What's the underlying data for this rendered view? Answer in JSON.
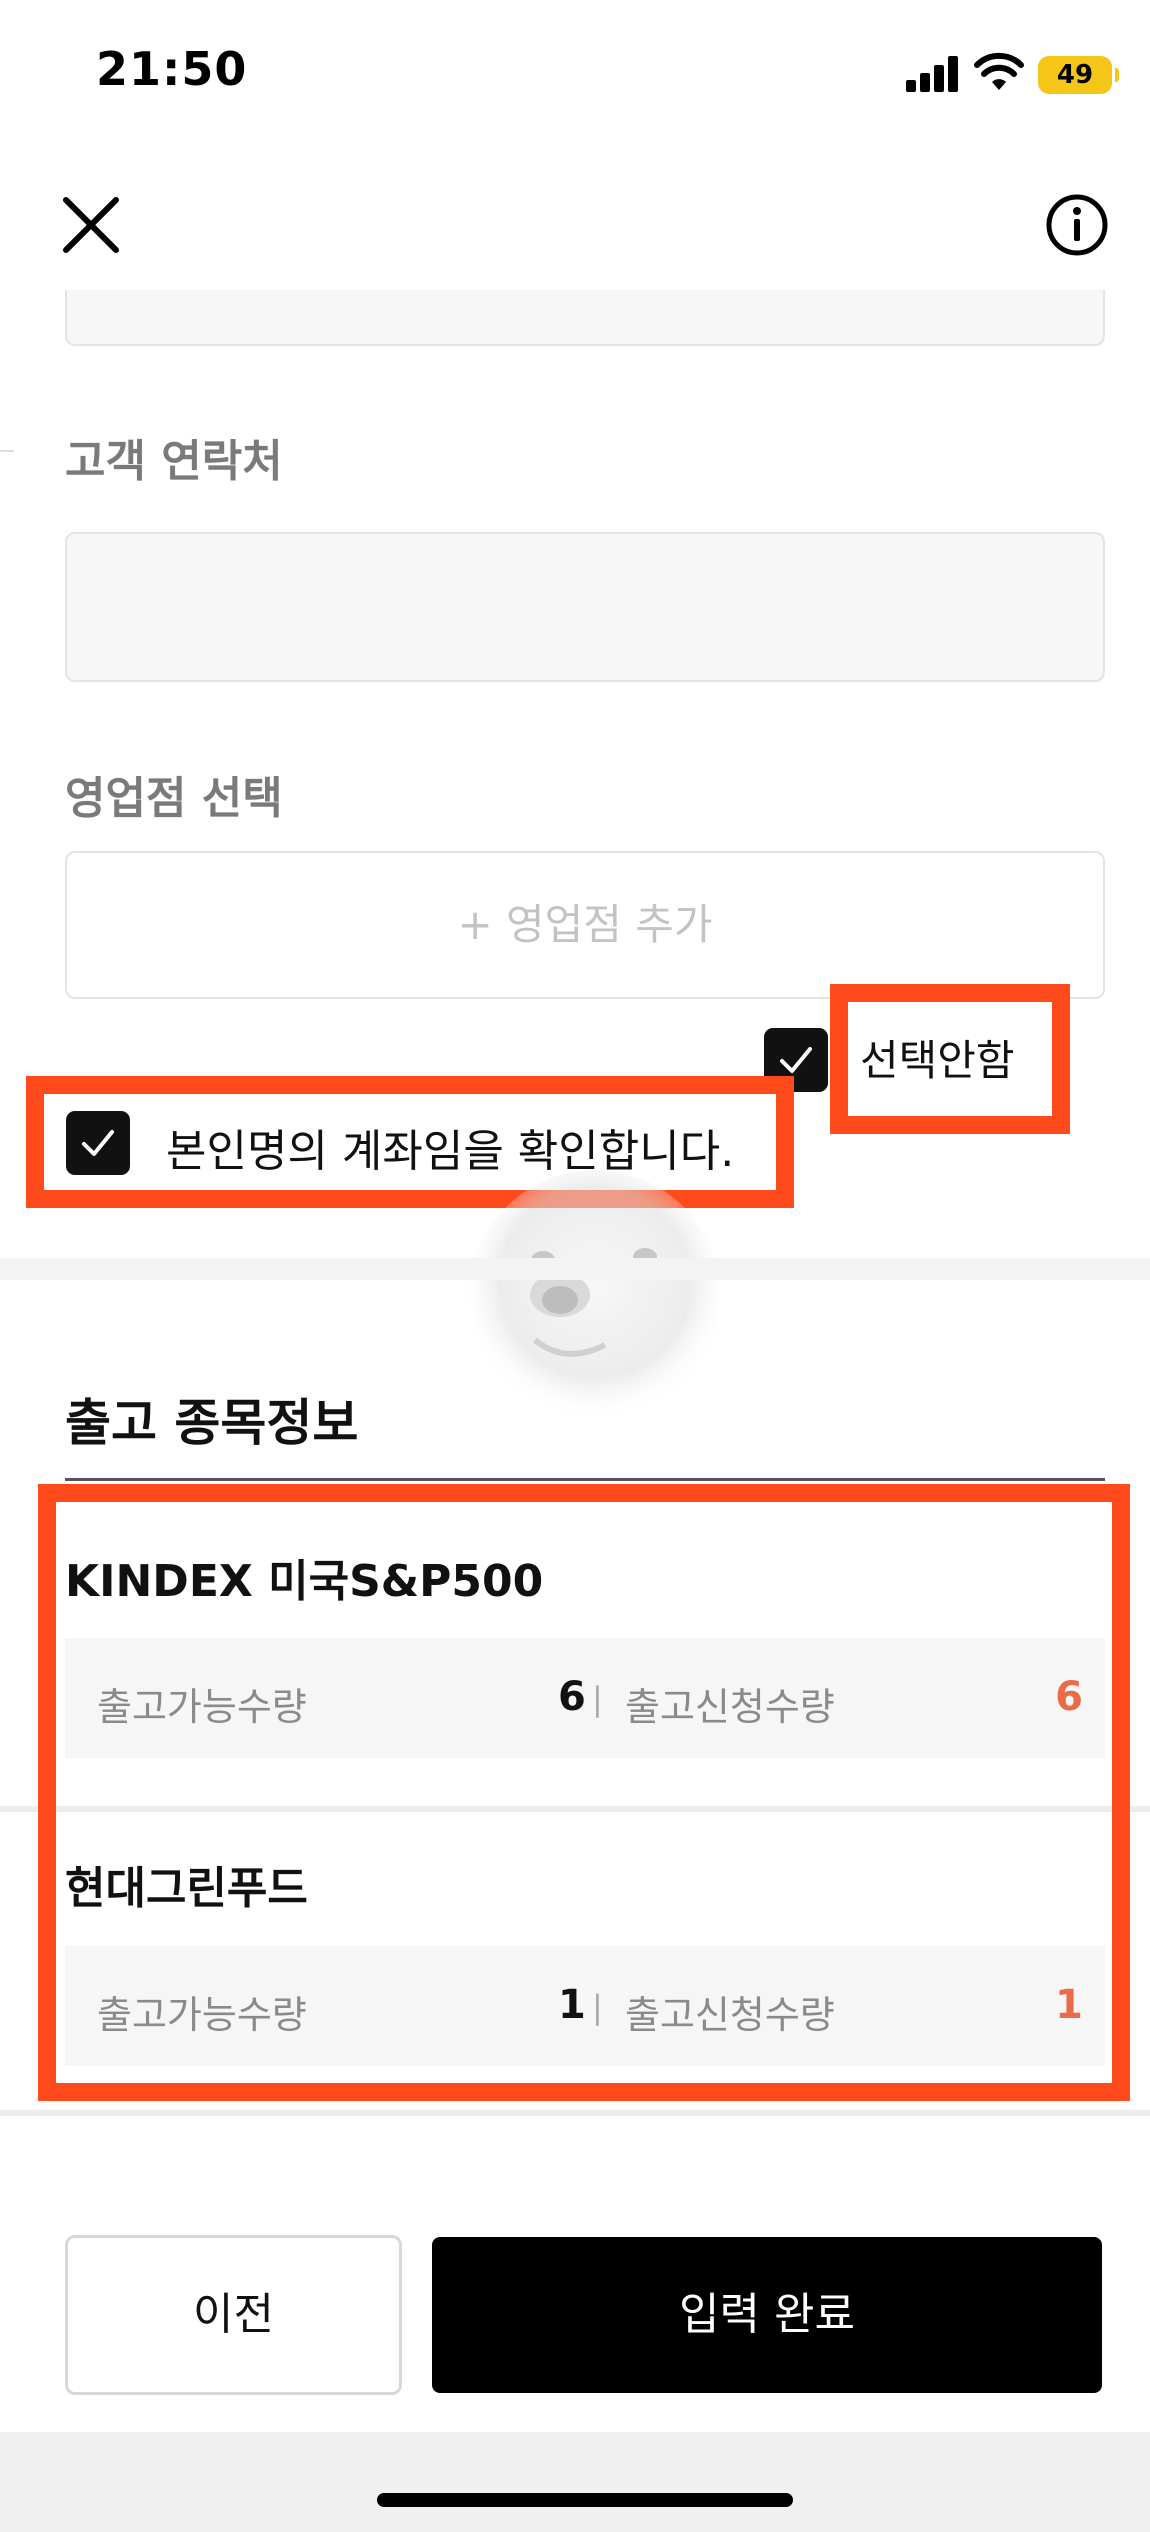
{
  "status_bar": {
    "time": "21:50",
    "battery": "49"
  },
  "header": {
    "close_icon": "close-icon",
    "info_icon": "info-icon"
  },
  "form": {
    "contact_label": "고객 연락처",
    "contact_value": "",
    "branch_label": "영업점 선택",
    "branch_add": "+ 영업점 추가",
    "branch_none_label": "선택안함",
    "branch_none_checked": true,
    "confirm_label": "본인명의 계좌임을 확인합니다.",
    "confirm_checked": true
  },
  "section": {
    "title": "출고 종목정보",
    "stocks": [
      {
        "name": "KINDEX 미국S&P500",
        "available_label": "출고가능수량",
        "available_qty": "6",
        "request_label": "출고신청수량",
        "request_qty": "6"
      },
      {
        "name": "현대그린푸드",
        "available_label": "출고가능수량",
        "available_qty": "1",
        "request_label": "출고신청수량",
        "request_qty": "1"
      }
    ]
  },
  "footer": {
    "prev_label": "이전",
    "done_label": "입력 완료"
  },
  "colors": {
    "accent_red": "#ff4a1c",
    "qty_red": "#ea6a4a",
    "primary": "#000000",
    "battery": "#f5c518"
  }
}
